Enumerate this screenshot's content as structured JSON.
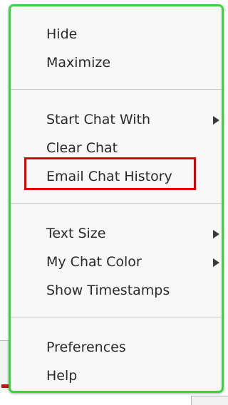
{
  "menu": {
    "groups": [
      {
        "items": [
          {
            "label": "Hide",
            "submenu": false
          },
          {
            "label": "Maximize",
            "submenu": false
          }
        ]
      },
      {
        "items": [
          {
            "label": "Start Chat With",
            "submenu": true
          },
          {
            "label": "Clear Chat",
            "submenu": false
          },
          {
            "label": "Email Chat History",
            "submenu": false,
            "highlighted": true
          }
        ]
      },
      {
        "items": [
          {
            "label": "Text Size",
            "submenu": true
          },
          {
            "label": "My Chat Color",
            "submenu": true
          },
          {
            "label": "Show Timestamps",
            "submenu": false
          }
        ]
      },
      {
        "items": [
          {
            "label": "Preferences",
            "submenu": false
          },
          {
            "label": "Help",
            "submenu": false
          }
        ]
      }
    ],
    "icons": {
      "submenu_arrow": "chevron-right-icon"
    },
    "colors": {
      "menu_border": "#3cd23c",
      "highlight_border": "#e00000",
      "menu_background": "#f8f8f8",
      "text": "#2a2a2a"
    }
  }
}
